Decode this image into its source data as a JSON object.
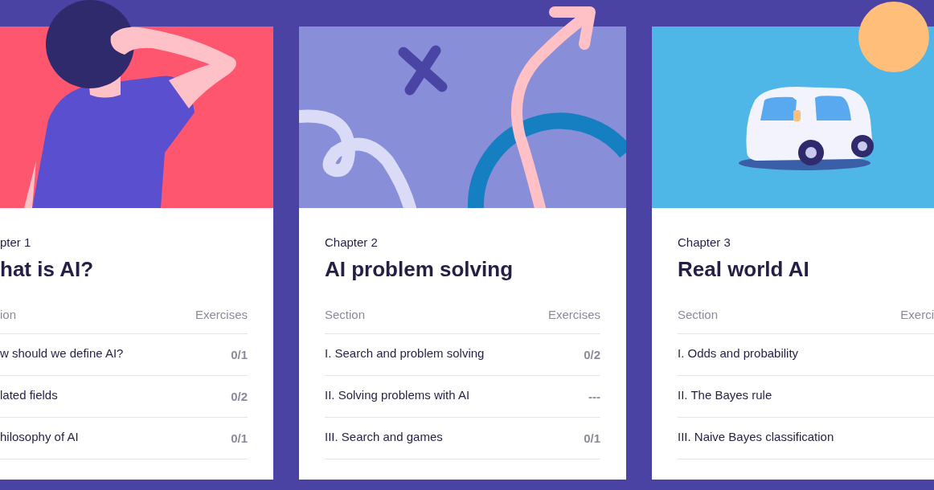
{
  "chapters": [
    {
      "kind": "person",
      "chapter_label": "pter 1",
      "title": "hat is AI?",
      "columns": [
        "ion",
        "Exercises"
      ],
      "sections": [
        {
          "name": "w should we define AI?",
          "exercises": "0/1"
        },
        {
          "name": "lated fields",
          "exercises": "0/2"
        },
        {
          "name": "hilosophy of AI",
          "exercises": "0/1"
        }
      ]
    },
    {
      "kind": "arrow",
      "chapter_label": "Chapter 2",
      "title": "AI problem solving",
      "columns": [
        "Section",
        "Exercises"
      ],
      "sections": [
        {
          "name": "I. Search and problem solving",
          "exercises": "0/2"
        },
        {
          "name": "II. Solving problems with AI",
          "exercises": "---"
        },
        {
          "name": "III. Search and games",
          "exercises": "0/1"
        }
      ]
    },
    {
      "kind": "car",
      "chapter_label": "Chapter 3",
      "title": "Real world AI",
      "columns": [
        "Section",
        "Exerci"
      ],
      "sections": [
        {
          "name": "I. Odds and probability"
        },
        {
          "name": "II. The Bayes rule"
        },
        {
          "name": "III. Naive Bayes classification"
        }
      ]
    }
  ]
}
